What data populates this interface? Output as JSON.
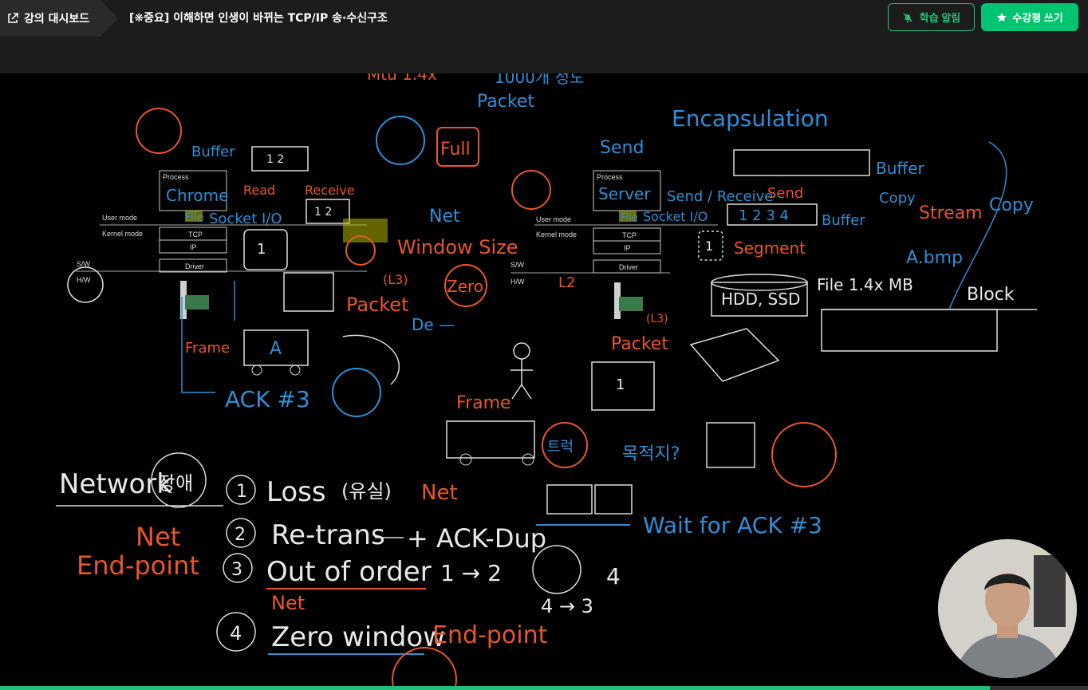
{
  "header": {
    "dashboard_label": "강의 대시보드",
    "lecture_title": "[❋중요] 이해하면 인생이 바뀌는 TCP/IP 송·수신구조",
    "alarm_button": "학습 알림",
    "review_button": "수강평 쓰기"
  },
  "colors": {
    "accent": "#00c471",
    "orange_ink": "#e8572a",
    "blue_ink": "#2f8fd6"
  },
  "progress": 0.91,
  "whiteboard": {
    "left_stack": {
      "user_mode": "User mode",
      "kernel_mode": "Kernel mode",
      "process": "Process",
      "tcp": "TCP",
      "ip": "IP",
      "driver": "Driver",
      "sw": "S/W",
      "hw": "H/W"
    },
    "right_stack": {
      "user_mode": "User mode",
      "kernel_mode": "Kernel mode",
      "process": "Process",
      "tcp": "TCP",
      "ip": "IP",
      "driver": "Driver",
      "sw": "S/W",
      "hw": "H/W"
    },
    "notes": {
      "buffer": "Buffer",
      "chrome": "Chrome",
      "file": "File",
      "socket_io": "Socket I/O",
      "read": "Read",
      "receive": "Receive",
      "net": "Net",
      "full": "Full",
      "window_size": "Window Size",
      "zero": "Zero",
      "l3": "(L3)",
      "packet": "Packet",
      "frame": "Frame",
      "a": "A",
      "ack3": "ACK #3",
      "send": "Send",
      "server": "Server",
      "encapsulation": "Encapsulation",
      "send_receive": "Send / Receive",
      "buffer2": "Buffer",
      "copy": "Copy",
      "stream": "Stream",
      "copy2": "Copy",
      "segment": "Segment",
      "a_bmp": "A.bmp",
      "file_size": "File 1.4x MB",
      "hdd_ssd": "HDD, SSD",
      "block": "Block",
      "packet2": "Packet",
      "frame2": "Frame",
      "truck_dest": "목적지?",
      "wait_ack": "Wait for ACK #3",
      "network_issue": "Network",
      "issue_circle": "장애",
      "loss": "Loss",
      "loss_kr": "(유실)",
      "net_red": "Net",
      "retrans": "Re-trans",
      "ack_dup": "+ ACK-Dup",
      "net_left": "Net",
      "endpoint_left": "End-point",
      "out_of_order": "Out of order",
      "ooo_seq": "1 → 2",
      "ooo_seq2": "4 → 3",
      "zero_window": "Zero window",
      "endpoint_right": "End-point",
      "packet_top": "Packet",
      "top_count": "1000개 정도"
    }
  }
}
